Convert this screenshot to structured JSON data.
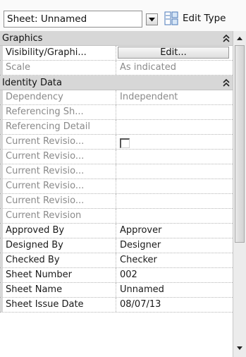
{
  "type_selector": {
    "value": "Sheet: Unnamed"
  },
  "edit_type": {
    "label": "Edit Type"
  },
  "groups": [
    {
      "label": "Graphics",
      "collapse_icon": "double-chevron-up-icon"
    },
    {
      "label": "Identity Data",
      "collapse_icon": "double-chevron-up-icon"
    }
  ],
  "graphics_rows": [
    {
      "name": "Visibility/Graphi...",
      "value": "Edit...",
      "editable": true
    },
    {
      "name": "Scale",
      "value": "As indicated",
      "editable": false
    }
  ],
  "identity_rows": [
    {
      "name": "Dependency",
      "value": "Independent",
      "editable": false
    },
    {
      "name": "Referencing Sh...",
      "value": "",
      "editable": false
    },
    {
      "name": "Referencing Detail",
      "value": "",
      "editable": false
    },
    {
      "name": "Current Revisio...",
      "value": "",
      "editable": false,
      "checkbox": true
    },
    {
      "name": "Current Revisio...",
      "value": "",
      "editable": false
    },
    {
      "name": "Current Revisio...",
      "value": "",
      "editable": false
    },
    {
      "name": "Current Revisio...",
      "value": "",
      "editable": false
    },
    {
      "name": "Current Revisio...",
      "value": "",
      "editable": false
    },
    {
      "name": "Current Revision",
      "value": "",
      "editable": false
    },
    {
      "name": "Approved By",
      "value": "Approver",
      "editable": true
    },
    {
      "name": "Designed By",
      "value": "Designer",
      "editable": true
    },
    {
      "name": "Checked By",
      "value": "Checker",
      "editable": true
    },
    {
      "name": "Sheet Number",
      "value": "002",
      "editable": true
    },
    {
      "name": "Sheet Name",
      "value": "Unnamed",
      "editable": true
    },
    {
      "name": "Sheet Issue Date",
      "value": "08/07/13",
      "editable": true
    }
  ]
}
